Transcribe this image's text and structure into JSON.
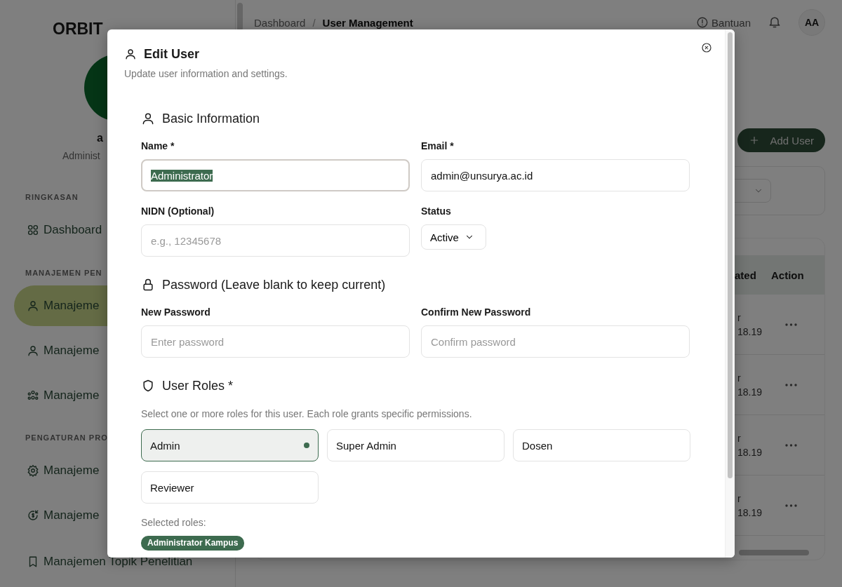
{
  "sidebar": {
    "logo": {
      "primary": "ORBIT"
    },
    "user": {
      "name": "a",
      "role": "Administ"
    },
    "sections": [
      {
        "title": "RINGKASAN",
        "items": [
          {
            "label": "Dashboard",
            "selected": false
          }
        ]
      },
      {
        "title": "MANAJEMEN PEN",
        "items": [
          {
            "label": "Manajeme",
            "selected": true
          },
          {
            "label": "Manajeme",
            "selected": false
          },
          {
            "label": "Manajeme",
            "selected": false
          }
        ]
      },
      {
        "title": "PENGATURAN PRO",
        "items": [
          {
            "label": "Manajeme",
            "selected": false
          },
          {
            "label": "Manajeme",
            "selected": false
          },
          {
            "label": "Manajemen Topik Penelitian",
            "selected": false
          }
        ]
      }
    ]
  },
  "header": {
    "breadcrumb": [
      {
        "label": "Dashboard"
      },
      {
        "label": "User Management"
      }
    ],
    "separator": "/",
    "help": "Bantuan",
    "avatar": "AA"
  },
  "add_button": "Add User",
  "table": {
    "columns": [
      "ated",
      "Action"
    ],
    "rows": [
      {
        "column_1": [
          "r",
          "18.19"
        ]
      },
      {
        "column_1": [
          "r",
          "18.19"
        ]
      },
      {
        "column_1": [
          "r",
          "18.19"
        ]
      },
      {
        "column_1": [
          "r",
          "18.19"
        ]
      }
    ]
  },
  "modal": {
    "title": "Edit User",
    "subtitle": "Update user information and settings.",
    "sections": [
      {
        "kind": "fields",
        "title": "Basic Information",
        "fields": [
          {
            "kind": "text",
            "label": "Name *",
            "value": "Administrator",
            "focused": true
          },
          {
            "kind": "text",
            "label": "Email *",
            "value": "admin@unsurya.ac.id",
            "focused": false
          },
          {
            "kind": "text",
            "label": "NIDN (Optional)",
            "placeholder": "e.g., 12345678",
            "focused": false
          },
          {
            "kind": "select",
            "label": "Status",
            "value": "Active",
            "focused": false
          }
        ]
      },
      {
        "kind": "fields",
        "title": "Password (Leave blank to keep current)",
        "fields": [
          {
            "kind": "text",
            "label": "New Password",
            "placeholder": "Enter password",
            "focused": false
          },
          {
            "kind": "text",
            "label": "Confirm New Password",
            "placeholder": "Confirm password",
            "focused": false
          }
        ]
      },
      {
        "kind": "roles",
        "title": "User Roles *",
        "description": "Select one or more roles for this user. Each role grants specific permissions.",
        "roles": [
          {
            "label": "Admin",
            "selected": true
          },
          {
            "label": "Super Admin",
            "selected": false
          },
          {
            "label": "Dosen",
            "selected": false
          },
          {
            "label": "Reviewer",
            "selected": false
          }
        ],
        "selected_label": "Selected roles:",
        "chips": [
          "Administrator Kampus"
        ]
      }
    ]
  }
}
